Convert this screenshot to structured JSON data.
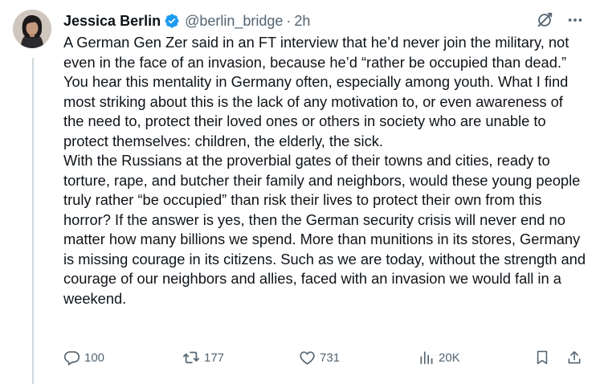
{
  "tweet": {
    "author_name": "Jessica Berlin",
    "handle": "@berlin_bridge",
    "separator": "·",
    "time": "2h",
    "paragraphs": [
      "A German Gen Zer said in an FT interview that he’d never join the military, not even in the face of an invasion, because he’d “rather be occupied than dead.”",
      "You hear this mentality in Germany often, especially among youth. What I find most striking about this is the lack of any motivation to, or even awareness of the need to, protect their loved ones or others in society who are unable to protect themselves: children, the elderly, the sick.",
      "With the Russians at the proverbial gates of their towns and cities, ready to torture, rape, and butcher their family and neighbors, would these young people truly rather “be occupied” than risk their lives to protect their own from this horror? If the answer is yes, then the German security crisis will never end no matter how many billions we spend. More than munitions in its stores, Germany is missing courage in its citizens. Such as we are today, without the strength and courage of our neighbors and allies, faced with an invasion we would fall in a weekend."
    ]
  },
  "actions": {
    "replies": "100",
    "reposts": "177",
    "likes": "731",
    "views": "20K"
  },
  "icons": {
    "verified": "verified-badge-icon",
    "grok": "grok-icon",
    "more": "more-options-icon",
    "reply": "reply-icon",
    "repost": "repost-icon",
    "like": "heart-icon",
    "views": "views-icon",
    "bookmark": "bookmark-icon",
    "share": "share-icon"
  },
  "colors": {
    "text": "#0f1419",
    "secondary": "#536471",
    "verified": "#1d9bf0",
    "thread_line": "#cfd9de"
  }
}
